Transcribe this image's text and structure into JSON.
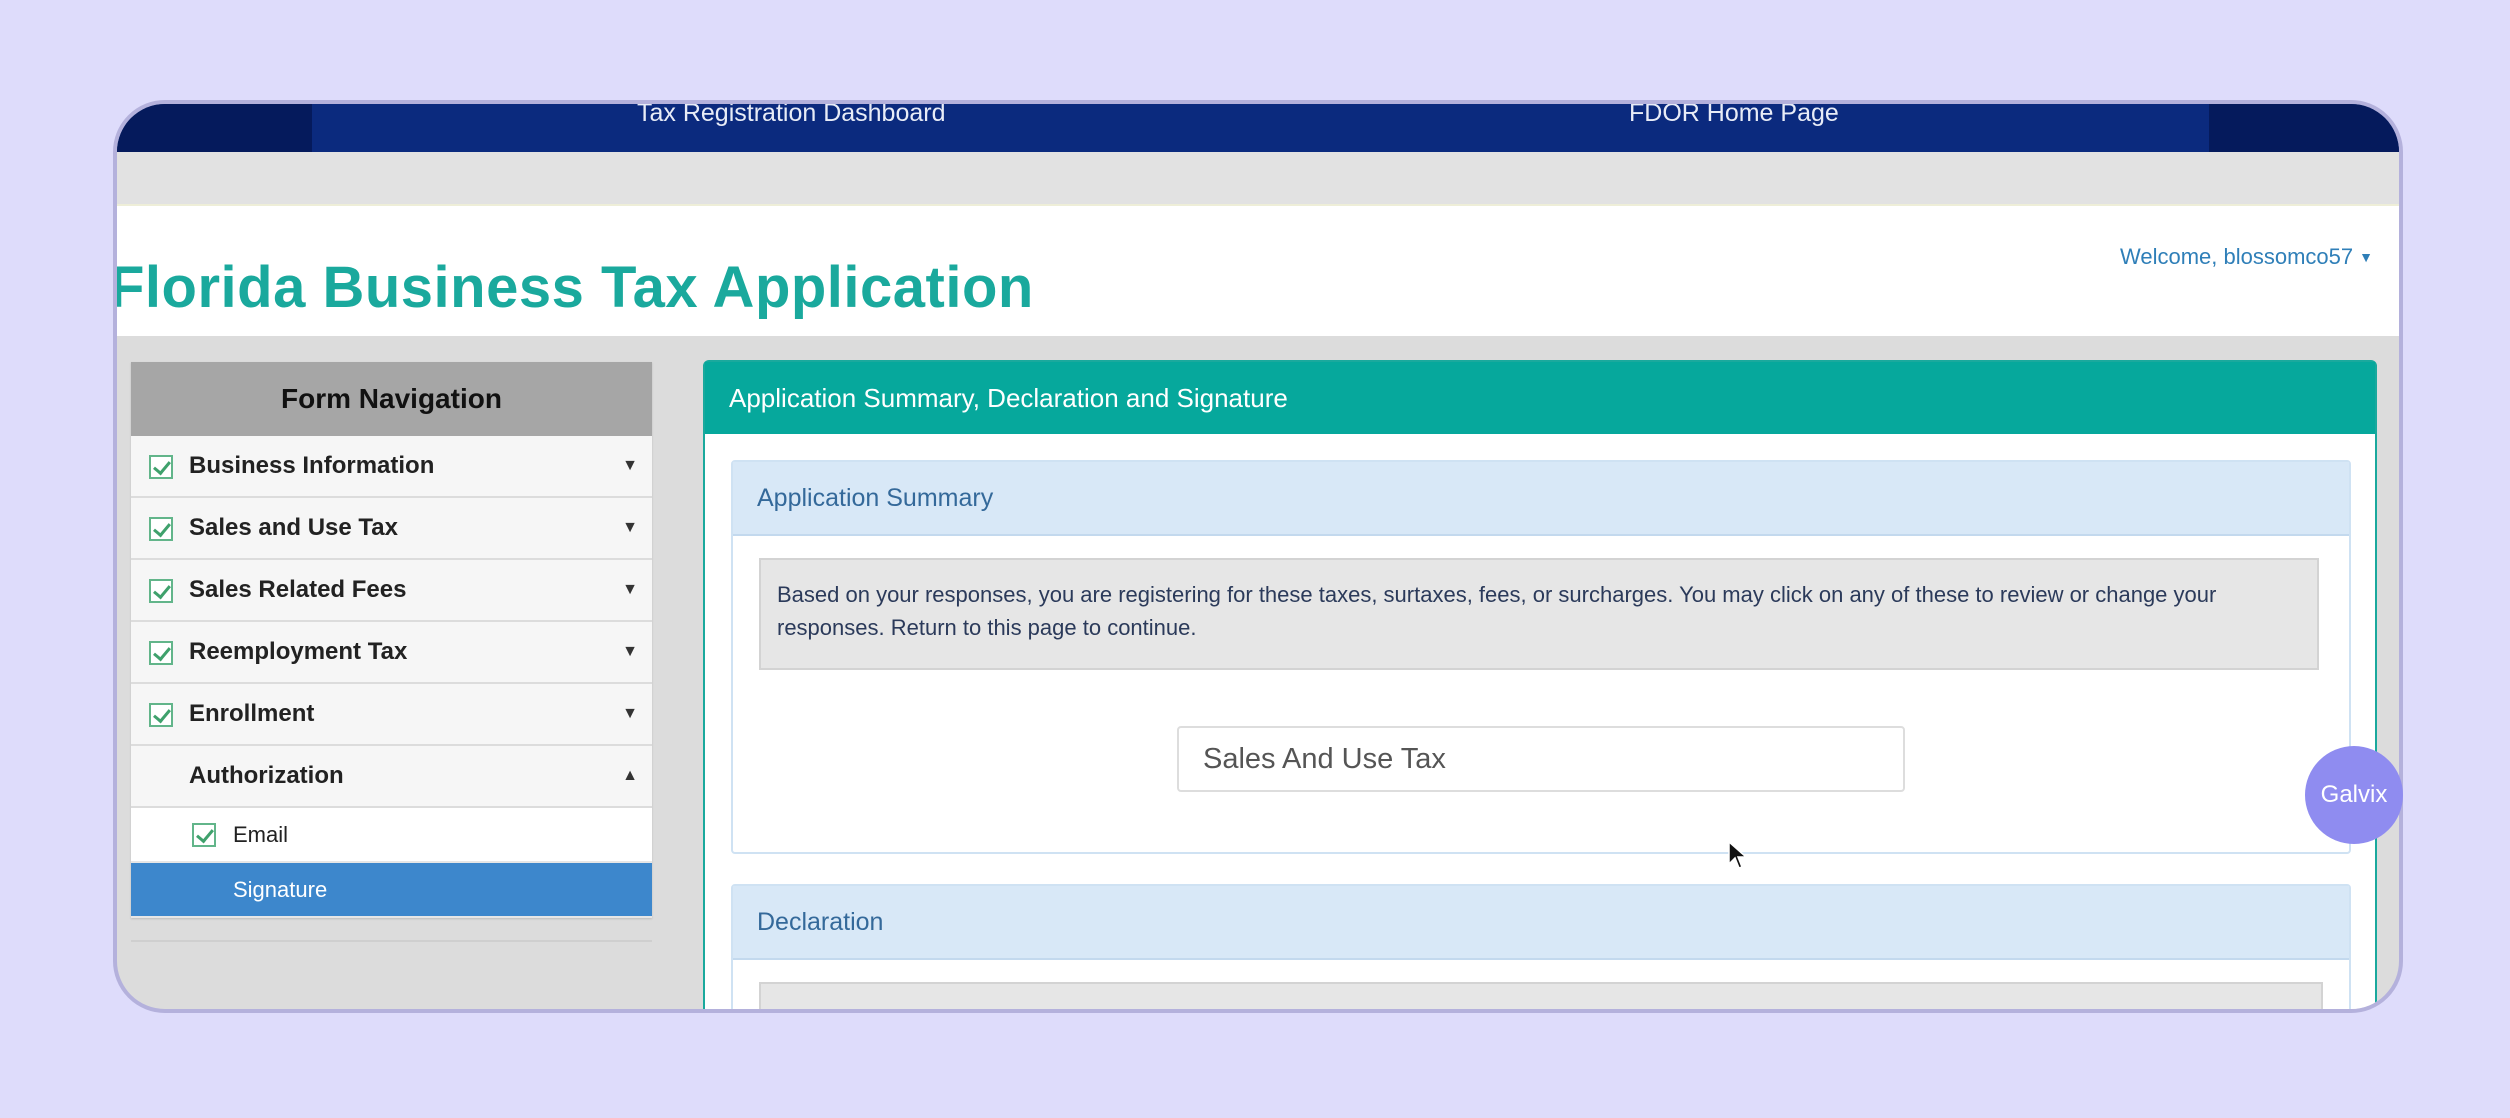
{
  "topbar": {
    "links": [
      "Tax Registration Dashboard",
      "FDOR Home Page"
    ]
  },
  "header": {
    "title": "Florida Business Tax Application",
    "welcome": "Welcome, blossomco57"
  },
  "sidebar": {
    "title": "Form Navigation",
    "items": [
      {
        "label": "Business Information",
        "checked": true
      },
      {
        "label": "Sales and Use Tax",
        "checked": true
      },
      {
        "label": "Sales Related Fees",
        "checked": true
      },
      {
        "label": "Reemployment Tax",
        "checked": true
      },
      {
        "label": "Enrollment",
        "checked": true
      },
      {
        "label": "Authorization",
        "checked": false
      }
    ],
    "subitems": [
      {
        "label": "Email",
        "checked": true
      },
      {
        "label": "Signature",
        "active": true
      }
    ]
  },
  "main": {
    "title": "Application Summary, Declaration and Signature",
    "summary": {
      "title": "Application Summary",
      "notice": "Based on your responses, you are registering for these taxes, surtaxes, fees, or surcharges. You may click on any of these to review or change your responses. Return to this page to continue.",
      "taxes": [
        "Sales And Use Tax"
      ]
    },
    "declaration": {
      "title": "Declaration"
    }
  },
  "overlay": {
    "badge": "Galvix"
  },
  "colors": {
    "accent": "#06a89c",
    "nav_active": "#3d87cc",
    "topbar": "#0b2a7e"
  }
}
